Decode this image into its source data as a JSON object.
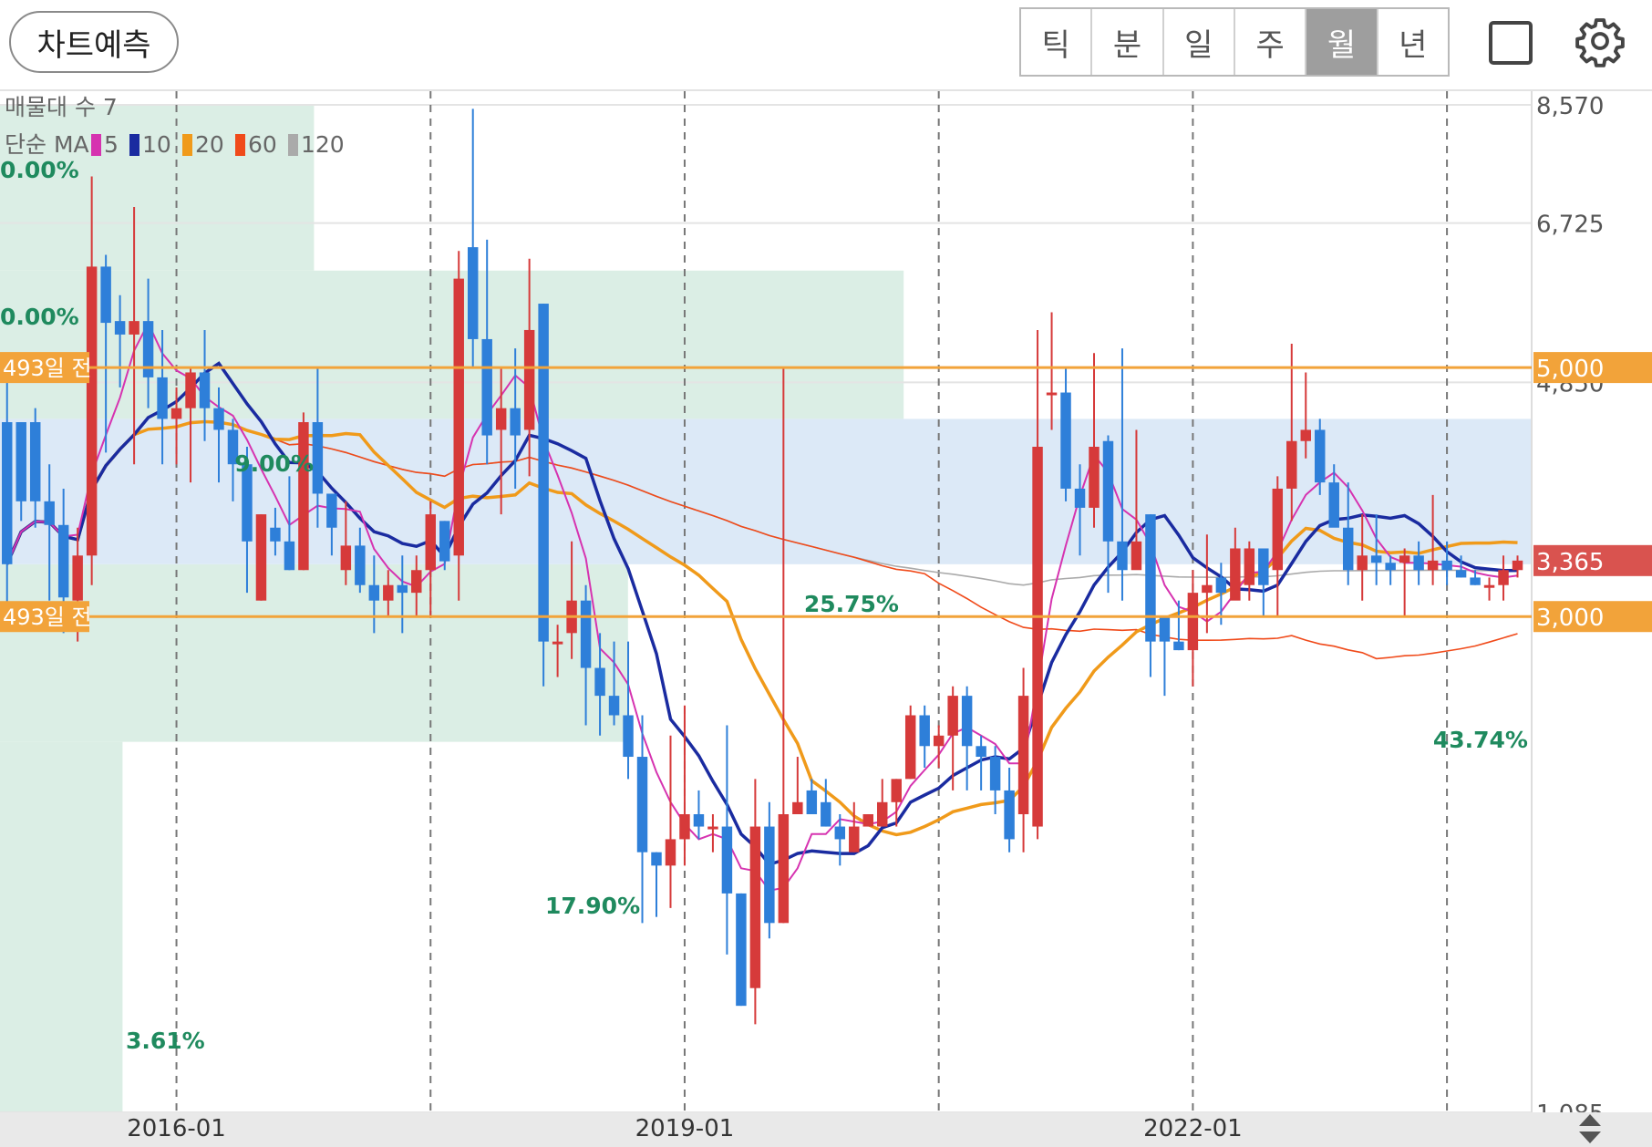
{
  "toolbar": {
    "predict_label": "차트예측",
    "periods": [
      "틱",
      "분",
      "일",
      "주",
      "월",
      "년"
    ],
    "active_period": "월",
    "fullscreen_icon": "fullscreen-icon",
    "settings_icon": "gear-icon"
  },
  "colors": {
    "up": "#d63a3a",
    "down": "#2e7fd9",
    "ma5": "#d633b0",
    "ma10": "#1a2ba0",
    "ma20": "#f09a1a",
    "ma60": "#f04a1a",
    "ma120": "#aaaaaa",
    "line_level": "#f2a33a",
    "last_price": "#d9534f",
    "zone_green": "#dbeee5",
    "zone_blue": "#dce9f7",
    "pct_text": "#1f8a5e"
  },
  "chart_data": {
    "type": "candlestick",
    "interval": "monthly",
    "y_scale": "log",
    "ylim": [
      1085,
      8570
    ],
    "y_ticks": [
      "8,570",
      "6,725",
      "4,850",
      "1,085"
    ],
    "y_tick_values": [
      8570,
      6725,
      4850,
      1085
    ],
    "x_tick_labels": [
      "2016-01",
      "2019-01",
      "2022-01"
    ],
    "x_tick_months": [
      12,
      48,
      84
    ],
    "n_months": 108,
    "grid": true,
    "volume_profile_label": "매물대 수 7",
    "ma_legend": {
      "prefix": "단순 MA",
      "periods": [
        "5",
        "10",
        "20",
        "60",
        "120"
      ]
    },
    "volume_profile": [
      {
        "low": 1085,
        "high": 2320,
        "pct": "3.61%",
        "width": 0.08
      },
      {
        "low": 2320,
        "high": 3340,
        "pct": "17.90%",
        "width": 0.41
      },
      {
        "low": 3340,
        "high": 4500,
        "pct": "43.74%",
        "width": 1.0
      },
      {
        "low": 4500,
        "high": 6100,
        "pct": "25.75%",
        "width": 0.59
      },
      {
        "low": 6100,
        "high": 8570,
        "pct": "9.00%",
        "width": 0.205
      },
      {
        "pct": "0.00%",
        "width": 0
      },
      {
        "pct": "0.00%",
        "width": 0
      }
    ],
    "horizontal_levels": [
      {
        "value": 5000,
        "label": "5,000",
        "note": "493일 전"
      },
      {
        "value": 3000,
        "label": "3,000",
        "note": "493일 전"
      }
    ],
    "last_price": {
      "value": 3365,
      "label": "3,365"
    },
    "candles": [
      [
        4470,
        3340,
        4900,
        3000
      ],
      [
        4470,
        3800,
        4470,
        3650
      ],
      [
        4470,
        3800,
        4600,
        3600
      ],
      [
        3800,
        3620,
        4100,
        3100
      ],
      [
        3620,
        3120,
        3900,
        2900
      ],
      [
        3100,
        3400,
        3600,
        2850
      ],
      [
        3400,
        6150,
        7400,
        3200
      ],
      [
        6150,
        5480,
        6300,
        4200
      ],
      [
        5500,
        5350,
        5800,
        4800
      ],
      [
        5350,
        5500,
        6950,
        4100
      ],
      [
        5500,
        4900,
        6000,
        4600
      ],
      [
        4900,
        4500,
        5400,
        4100
      ],
      [
        4500,
        4600,
        4800,
        4100
      ],
      [
        4600,
        4950,
        5000,
        3950
      ],
      [
        4950,
        4600,
        5400,
        4300
      ],
      [
        4600,
        4400,
        4800,
        3950
      ],
      [
        4400,
        4100,
        4500,
        3800
      ],
      [
        4100,
        3500,
        4250,
        3150
      ],
      [
        3100,
        3700,
        3700,
        3100
      ],
      [
        3600,
        3500,
        3750,
        3400
      ],
      [
        3500,
        3300,
        4000,
        3300
      ],
      [
        3300,
        4470,
        4560,
        3300
      ],
      [
        4470,
        3860,
        5000,
        3600
      ],
      [
        3860,
        3600,
        3860,
        3400
      ],
      [
        3300,
        3470,
        3800,
        3200
      ],
      [
        3470,
        3200,
        3600,
        3150
      ],
      [
        3200,
        3100,
        3400,
        2900
      ],
      [
        3100,
        3200,
        3300,
        3000
      ],
      [
        3200,
        3150,
        3400,
        2900
      ],
      [
        3150,
        3300,
        3400,
        3000
      ],
      [
        3300,
        3700,
        3800,
        3000
      ],
      [
        3650,
        3360,
        3650,
        3300
      ],
      [
        3400,
        6000,
        6350,
        3100
      ],
      [
        6400,
        5300,
        8500,
        5000
      ],
      [
        5300,
        4350,
        6500,
        4100
      ],
      [
        4400,
        4600,
        5000,
        3700
      ],
      [
        4600,
        4350,
        5200,
        3900
      ],
      [
        4400,
        5400,
        6250,
        4000
      ],
      [
        5700,
        2850,
        5700,
        2600
      ],
      [
        2850,
        2850,
        2950,
        2650
      ],
      [
        2900,
        3100,
        3500,
        2750
      ],
      [
        3100,
        2700,
        3200,
        2400
      ],
      [
        2700,
        2550,
        2900,
        2350
      ],
      [
        2550,
        2450,
        2850,
        2400
      ],
      [
        2450,
        2250,
        2850,
        2150
      ],
      [
        2250,
        1850,
        2450,
        1600
      ],
      [
        1850,
        1800,
        1850,
        1620
      ],
      [
        1800,
        1900,
        2350,
        1650
      ],
      [
        1900,
        2000,
        2500,
        1800
      ],
      [
        2000,
        1950,
        2100,
        1900
      ],
      [
        1950,
        1950,
        2000,
        1850
      ],
      [
        1950,
        1700,
        2400,
        1500
      ],
      [
        1700,
        1350,
        1700,
        1350
      ],
      [
        1400,
        1950,
        2150,
        1300
      ],
      [
        1950,
        1600,
        2050,
        1550
      ],
      [
        1600,
        2000,
        5000,
        1600
      ],
      [
        2000,
        2050,
        2250,
        2000
      ],
      [
        2100,
        2000,
        2150,
        2000
      ],
      [
        2050,
        1950,
        2150,
        1950
      ],
      [
        1950,
        1900,
        2000,
        1800
      ],
      [
        1850,
        1950,
        2050,
        1850
      ],
      [
        1950,
        2000,
        2000,
        1950
      ],
      [
        1950,
        2050,
        2150,
        1950
      ],
      [
        2050,
        2150,
        2150,
        1950
      ],
      [
        2150,
        2450,
        2500,
        2150
      ],
      [
        2450,
        2300,
        2500,
        2200
      ],
      [
        2300,
        2350,
        2400,
        2200
      ],
      [
        2350,
        2550,
        2600,
        2100
      ],
      [
        2550,
        2300,
        2600,
        2100
      ],
      [
        2300,
        2250,
        2350,
        2100
      ],
      [
        2250,
        2100,
        2300,
        2000
      ],
      [
        2100,
        1900,
        2200,
        1850
      ],
      [
        2000,
        2550,
        2700,
        1850
      ],
      [
        1950,
        4250,
        5400,
        1900
      ],
      [
        4750,
        4750,
        5600,
        4400
      ],
      [
        4750,
        3900,
        5000,
        3800
      ],
      [
        3900,
        3750,
        4100,
        3400
      ],
      [
        3750,
        4250,
        5150,
        3600
      ],
      [
        4300,
        3500,
        4350,
        3150
      ],
      [
        3500,
        3300,
        5200,
        3100
      ],
      [
        3300,
        3500,
        4400,
        3350
      ],
      [
        3700,
        2850,
        3700,
        2650
      ],
      [
        3000,
        2850,
        3000,
        2550
      ],
      [
        2850,
        2800,
        3100,
        2800
      ],
      [
        2800,
        3150,
        3300,
        2600
      ],
      [
        3150,
        3200,
        3550,
        2900
      ],
      [
        3250,
        3150,
        3350,
        2950
      ],
      [
        3100,
        3450,
        3600,
        3150
      ],
      [
        3200,
        3450,
        3500,
        3100
      ],
      [
        3450,
        3200,
        3400,
        3000
      ],
      [
        3300,
        3900,
        4000,
        3000
      ],
      [
        3900,
        4300,
        5250,
        3650
      ],
      [
        4300,
        4400,
        4950,
        4150
      ],
      [
        4400,
        3950,
        4500,
        3850
      ],
      [
        3950,
        3600,
        4100,
        3700
      ],
      [
        3600,
        3300,
        3950,
        3200
      ],
      [
        3300,
        3400,
        3700,
        3100
      ],
      [
        3400,
        3350,
        3700,
        3200
      ],
      [
        3350,
        3300,
        3400,
        3200
      ],
      [
        3350,
        3400,
        3450,
        3000
      ],
      [
        3400,
        3300,
        3500,
        3200
      ],
      [
        3300,
        3365,
        3850,
        3200
      ],
      [
        3365,
        3300,
        3500,
        3200
      ],
      [
        3300,
        3250,
        3400,
        3250
      ],
      [
        3250,
        3200,
        3300,
        3200
      ],
      [
        3200,
        3200,
        3250,
        3100
      ],
      [
        3200,
        3300,
        3400,
        3100
      ],
      [
        3300,
        3365,
        3400,
        3250
      ]
    ]
  }
}
